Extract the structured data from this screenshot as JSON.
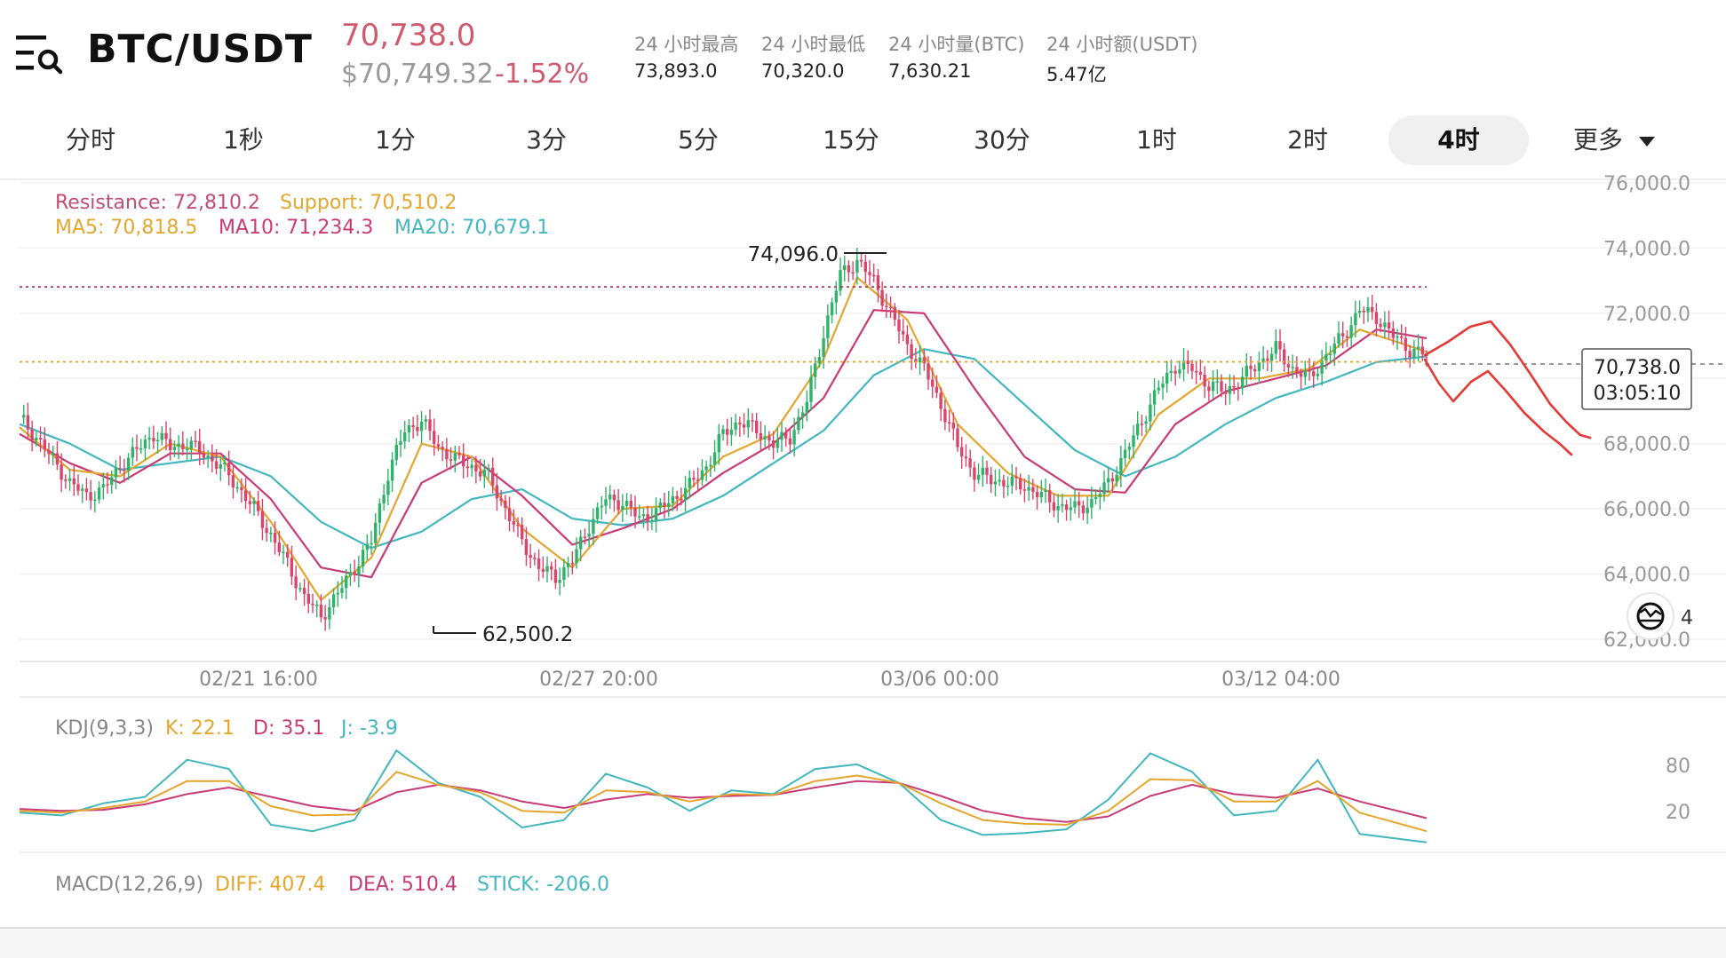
{
  "header": {
    "pair": "BTC/USDT",
    "last_price": "70,738.0",
    "usd_price": "$70,749.32",
    "change": "-1.52%",
    "stats": [
      {
        "label": "24 小时最高",
        "value": "73,893.0"
      },
      {
        "label": "24 小时最低",
        "value": "70,320.0"
      },
      {
        "label": "24 小时量(BTC)",
        "value": "7,630.21"
      },
      {
        "label": "24 小时额(USDT)",
        "value": "5.47亿"
      }
    ]
  },
  "tabs": [
    {
      "label": "分时"
    },
    {
      "label": "1秒"
    },
    {
      "label": "1分"
    },
    {
      "label": "3分"
    },
    {
      "label": "5分"
    },
    {
      "label": "15分"
    },
    {
      "label": "30分"
    },
    {
      "label": "1时"
    },
    {
      "label": "2时"
    },
    {
      "label": "4时",
      "active": true
    },
    {
      "label": "更多"
    }
  ],
  "legend": {
    "resistance": "Resistance: 72,810.2",
    "support": "Support: 70,510.2",
    "ma5": "MA5: 70,818.5",
    "ma10": "MA10: 71,234.3",
    "ma20": "MA20: 70,679.1"
  },
  "annotations": {
    "high": "74,096.0",
    "low": "62,500.2",
    "price_tag": "70,738.0",
    "countdown": "03:05:10",
    "indicator_badge": "4"
  },
  "kdj": {
    "title": "KDJ(9,3,3)",
    "k": "K: 22.1",
    "d": "D: 35.1",
    "j": "J: -3.9",
    "ticks": [
      "80",
      "20"
    ]
  },
  "macd": {
    "title": "MACD(12,26,9)",
    "diff": "DIFF: 407.4",
    "dea": "DEA: 510.4",
    "stick": "STICK: -206.0"
  },
  "colors": {
    "up": "#2fb36a",
    "down": "#d9456b",
    "ma5": "#e3a62f",
    "ma10": "#c73b78",
    "ma20": "#43b7c0",
    "resistance": "#b03a5b",
    "support": "#e3a62f",
    "kdj_k": "#e3a62f",
    "kdj_d": "#c73b78",
    "kdj_j": "#43b7c0",
    "drawing": "#e53935"
  },
  "chart_data": {
    "type": "candlestick",
    "title": "BTC/USDT 4时",
    "x_ticks": [
      "02/21 16:00",
      "02/27 20:00",
      "03/06 00:00",
      "03/12 04:00"
    ],
    "y_ticks": [
      62000,
      64000,
      66000,
      68000,
      70000,
      72000,
      74000,
      76000
    ],
    "y_tick_labels": [
      "62,000.0",
      "64,000.0",
      "66,000.0",
      "68,000.0",
      "70,000.0",
      "72,000.0",
      "74,000.0",
      "76,000.0"
    ],
    "ylim": [
      61400,
      76300
    ],
    "resistance": 72810.2,
    "support": 70510.2,
    "high_marker": 74096.0,
    "low_marker": 62500.2,
    "last_price": 70738.0,
    "close_path": [
      [
        0,
        68800
      ],
      [
        4,
        68200
      ],
      [
        8,
        67500
      ],
      [
        12,
        66800
      ],
      [
        16,
        66400
      ],
      [
        20,
        66600
      ],
      [
        24,
        67300
      ],
      [
        28,
        67800
      ],
      [
        32,
        68300
      ],
      [
        36,
        67900
      ],
      [
        40,
        68000
      ],
      [
        44,
        67700
      ],
      [
        48,
        67300
      ],
      [
        52,
        66700
      ],
      [
        56,
        66000
      ],
      [
        60,
        65200
      ],
      [
        64,
        64300
      ],
      [
        68,
        63300
      ],
      [
        72,
        62700
      ],
      [
        76,
        63400
      ],
      [
        80,
        64200
      ],
      [
        84,
        65000
      ],
      [
        88,
        67100
      ],
      [
        92,
        68400
      ],
      [
        96,
        68700
      ],
      [
        100,
        67900
      ],
      [
        104,
        67500
      ],
      [
        108,
        67300
      ],
      [
        112,
        67000
      ],
      [
        116,
        66000
      ],
      [
        120,
        65000
      ],
      [
        124,
        64200
      ],
      [
        128,
        63900
      ],
      [
        132,
        64400
      ],
      [
        136,
        65500
      ],
      [
        140,
        66300
      ],
      [
        144,
        66200
      ],
      [
        148,
        65700
      ],
      [
        152,
        65900
      ],
      [
        156,
        66300
      ],
      [
        160,
        66700
      ],
      [
        164,
        67300
      ],
      [
        168,
        68300
      ],
      [
        172,
        68700
      ],
      [
        176,
        68400
      ],
      [
        180,
        68000
      ],
      [
        184,
        68200
      ],
      [
        188,
        69300
      ],
      [
        192,
        71400
      ],
      [
        196,
        73200
      ],
      [
        200,
        73600
      ],
      [
        204,
        73000
      ],
      [
        208,
        72000
      ],
      [
        212,
        71000
      ],
      [
        216,
        70300
      ],
      [
        220,
        69200
      ],
      [
        224,
        67900
      ],
      [
        228,
        67100
      ],
      [
        232,
        66900
      ],
      [
        236,
        66800
      ],
      [
        240,
        66700
      ],
      [
        244,
        66400
      ],
      [
        248,
        66100
      ],
      [
        252,
        66000
      ],
      [
        256,
        66200
      ],
      [
        260,
        66800
      ],
      [
        264,
        67700
      ],
      [
        268,
        68700
      ],
      [
        272,
        69700
      ],
      [
        276,
        70400
      ],
      [
        280,
        70300
      ],
      [
        284,
        69800
      ],
      [
        288,
        69600
      ],
      [
        292,
        70000
      ],
      [
        296,
        70500
      ],
      [
        300,
        70900
      ],
      [
        304,
        70300
      ],
      [
        308,
        70000
      ],
      [
        312,
        70700
      ],
      [
        316,
        71300
      ],
      [
        320,
        72100
      ],
      [
        324,
        71900
      ],
      [
        328,
        71300
      ],
      [
        332,
        70900
      ],
      [
        336,
        70700
      ]
    ],
    "ma5_path": [
      [
        0,
        68500
      ],
      [
        12,
        67200
      ],
      [
        24,
        67000
      ],
      [
        36,
        68000
      ],
      [
        48,
        67600
      ],
      [
        60,
        65600
      ],
      [
        72,
        63200
      ],
      [
        84,
        64500
      ],
      [
        96,
        68000
      ],
      [
        108,
        67600
      ],
      [
        120,
        65400
      ],
      [
        132,
        64200
      ],
      [
        144,
        66000
      ],
      [
        156,
        66100
      ],
      [
        168,
        67600
      ],
      [
        180,
        68300
      ],
      [
        192,
        70600
      ],
      [
        200,
        73100
      ],
      [
        212,
        71800
      ],
      [
        224,
        68600
      ],
      [
        236,
        67100
      ],
      [
        248,
        66400
      ],
      [
        260,
        66400
      ],
      [
        272,
        68900
      ],
      [
        284,
        70000
      ],
      [
        296,
        70000
      ],
      [
        308,
        70300
      ],
      [
        320,
        71500
      ],
      [
        336,
        70818
      ]
    ],
    "ma10_path": [
      [
        0,
        68300
      ],
      [
        12,
        67400
      ],
      [
        24,
        66800
      ],
      [
        36,
        67700
      ],
      [
        48,
        67700
      ],
      [
        60,
        66300
      ],
      [
        72,
        64200
      ],
      [
        84,
        63900
      ],
      [
        96,
        66800
      ],
      [
        108,
        67600
      ],
      [
        120,
        66400
      ],
      [
        132,
        64900
      ],
      [
        144,
        65400
      ],
      [
        156,
        66000
      ],
      [
        168,
        67100
      ],
      [
        180,
        68000
      ],
      [
        192,
        69400
      ],
      [
        204,
        72100
      ],
      [
        216,
        72000
      ],
      [
        228,
        69700
      ],
      [
        240,
        67600
      ],
      [
        252,
        66600
      ],
      [
        264,
        66500
      ],
      [
        276,
        68600
      ],
      [
        288,
        69600
      ],
      [
        300,
        70000
      ],
      [
        312,
        70400
      ],
      [
        324,
        71500
      ],
      [
        336,
        71234
      ]
    ],
    "ma20_path": [
      [
        0,
        68600
      ],
      [
        12,
        68000
      ],
      [
        24,
        67200
      ],
      [
        36,
        67400
      ],
      [
        48,
        67600
      ],
      [
        60,
        67000
      ],
      [
        72,
        65600
      ],
      [
        84,
        64800
      ],
      [
        96,
        65300
      ],
      [
        108,
        66300
      ],
      [
        120,
        66600
      ],
      [
        132,
        65700
      ],
      [
        144,
        65500
      ],
      [
        156,
        65700
      ],
      [
        168,
        66400
      ],
      [
        180,
        67400
      ],
      [
        192,
        68400
      ],
      [
        204,
        70100
      ],
      [
        216,
        70900
      ],
      [
        228,
        70600
      ],
      [
        240,
        69200
      ],
      [
        252,
        67800
      ],
      [
        264,
        67000
      ],
      [
        276,
        67600
      ],
      [
        288,
        68600
      ],
      [
        300,
        69400
      ],
      [
        312,
        69900
      ],
      [
        324,
        70500
      ],
      [
        336,
        70679
      ]
    ],
    "kdj_k_path": [
      [
        0,
        30
      ],
      [
        10,
        28
      ],
      [
        20,
        33
      ],
      [
        30,
        40
      ],
      [
        40,
        62
      ],
      [
        50,
        62
      ],
      [
        60,
        35
      ],
      [
        70,
        25
      ],
      [
        80,
        26
      ],
      [
        90,
        72
      ],
      [
        100,
        58
      ],
      [
        110,
        50
      ],
      [
        120,
        30
      ],
      [
        130,
        28
      ],
      [
        140,
        52
      ],
      [
        150,
        50
      ],
      [
        160,
        40
      ],
      [
        170,
        48
      ],
      [
        180,
        47
      ],
      [
        190,
        62
      ],
      [
        200,
        68
      ],
      [
        210,
        60
      ],
      [
        220,
        38
      ],
      [
        230,
        20
      ],
      [
        240,
        16
      ],
      [
        250,
        15
      ],
      [
        260,
        30
      ],
      [
        270,
        64
      ],
      [
        280,
        63
      ],
      [
        290,
        40
      ],
      [
        300,
        40
      ],
      [
        310,
        62
      ],
      [
        320,
        28
      ],
      [
        336,
        8
      ]
    ],
    "kdj_d_path": [
      [
        0,
        32
      ],
      [
        10,
        30
      ],
      [
        20,
        31
      ],
      [
        30,
        37
      ],
      [
        40,
        48
      ],
      [
        50,
        55
      ],
      [
        60,
        45
      ],
      [
        70,
        35
      ],
      [
        80,
        30
      ],
      [
        90,
        50
      ],
      [
        100,
        58
      ],
      [
        110,
        52
      ],
      [
        120,
        40
      ],
      [
        130,
        33
      ],
      [
        140,
        42
      ],
      [
        150,
        48
      ],
      [
        160,
        44
      ],
      [
        170,
        46
      ],
      [
        180,
        47
      ],
      [
        190,
        55
      ],
      [
        200,
        62
      ],
      [
        210,
        60
      ],
      [
        220,
        46
      ],
      [
        230,
        30
      ],
      [
        240,
        22
      ],
      [
        250,
        18
      ],
      [
        260,
        24
      ],
      [
        270,
        46
      ],
      [
        280,
        58
      ],
      [
        290,
        48
      ],
      [
        300,
        44
      ],
      [
        310,
        54
      ],
      [
        320,
        40
      ],
      [
        336,
        22
      ]
    ],
    "kdj_j_path": [
      [
        0,
        28
      ],
      [
        10,
        25
      ],
      [
        20,
        38
      ],
      [
        30,
        45
      ],
      [
        40,
        85
      ],
      [
        50,
        75
      ],
      [
        60,
        15
      ],
      [
        70,
        8
      ],
      [
        80,
        20
      ],
      [
        90,
        95
      ],
      [
        100,
        60
      ],
      [
        110,
        45
      ],
      [
        120,
        12
      ],
      [
        130,
        20
      ],
      [
        140,
        70
      ],
      [
        150,
        55
      ],
      [
        160,
        30
      ],
      [
        170,
        52
      ],
      [
        180,
        48
      ],
      [
        190,
        75
      ],
      [
        200,
        80
      ],
      [
        210,
        60
      ],
      [
        220,
        20
      ],
      [
        230,
        4
      ],
      [
        240,
        6
      ],
      [
        250,
        10
      ],
      [
        260,
        42
      ],
      [
        270,
        92
      ],
      [
        280,
        72
      ],
      [
        290,
        25
      ],
      [
        300,
        30
      ],
      [
        310,
        85
      ],
      [
        320,
        5
      ],
      [
        336,
        -4
      ]
    ]
  }
}
